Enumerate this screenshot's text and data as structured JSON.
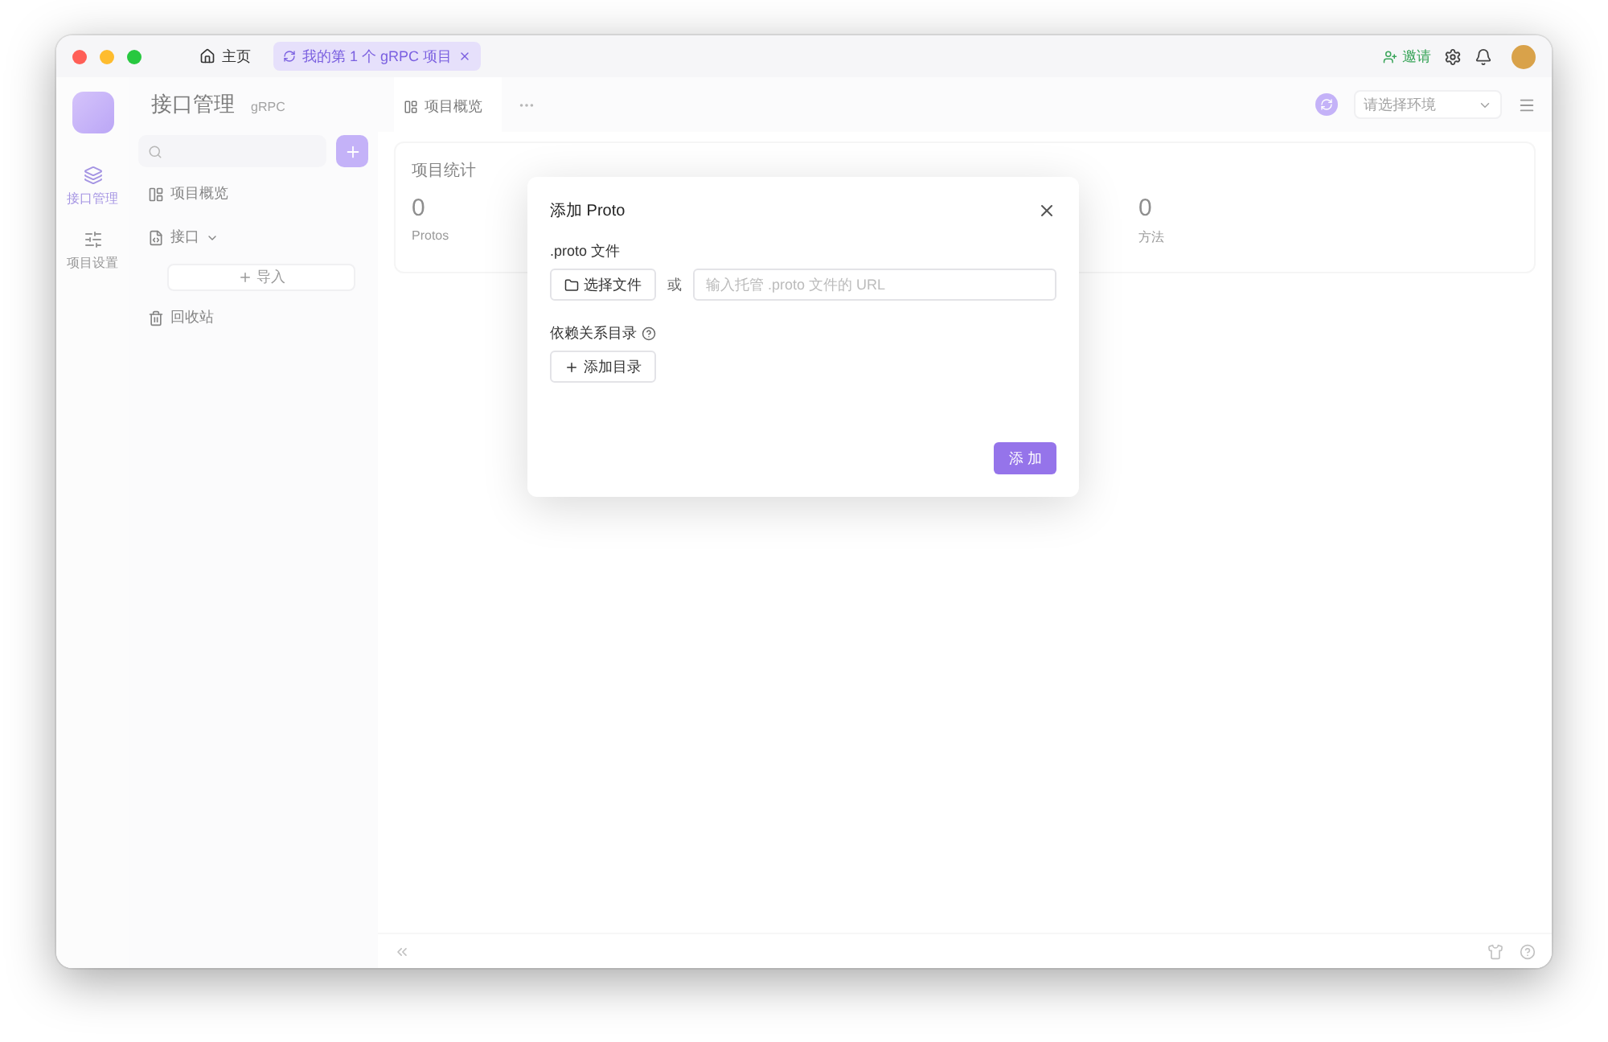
{
  "window": {
    "tabs": [
      {
        "label": "主页",
        "selected": false,
        "kind": "home"
      },
      {
        "label": "我的第 1 个 gRPC 项目",
        "selected": true,
        "kind": "project"
      }
    ],
    "invite": "邀请"
  },
  "rail": {
    "items": [
      {
        "label": "接口管理",
        "selected": true,
        "kind": "api"
      },
      {
        "label": "项目设置",
        "selected": false,
        "kind": "settings"
      }
    ]
  },
  "sidebar": {
    "title": "接口管理",
    "subtitle": "gRPC",
    "items": [
      {
        "label": "项目概览",
        "kind": "overview"
      },
      {
        "label": "接口",
        "kind": "api"
      },
      {
        "label": "导入",
        "kind": "import"
      },
      {
        "label": "回收站",
        "kind": "trash"
      }
    ]
  },
  "main": {
    "tabs": [
      {
        "label": "项目概览",
        "selected": true
      }
    ],
    "env_placeholder": "请选择环境",
    "stats": {
      "title": "项目统计",
      "items": [
        {
          "value": "0",
          "label": "Protos"
        },
        {
          "value": "0",
          "label": "方法"
        }
      ]
    }
  },
  "dialog": {
    "title": "添加 Proto",
    "file_label": ".proto 文件",
    "choose_button": "选择文件",
    "or": "或",
    "url_placeholder": "输入托管 .proto 文件的 URL",
    "deps_label": "依赖关系目录",
    "add_dir_button": "添加目录",
    "submit": "添 加"
  }
}
